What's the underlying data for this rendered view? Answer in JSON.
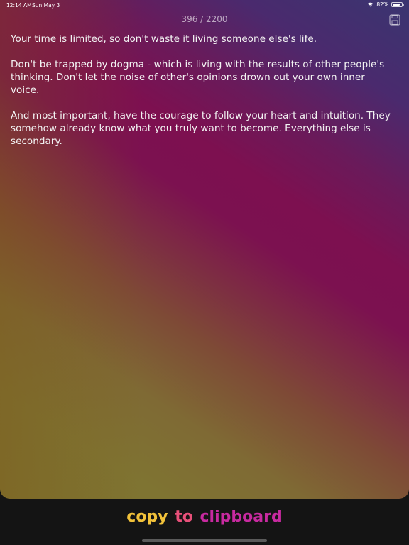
{
  "status_bar": {
    "time": "12:14 AM",
    "date": "Sun May 3",
    "battery_percent": "82%",
    "battery_level": 0.82
  },
  "counter": "396 / 2200",
  "save_icon": "floppy-disk-icon",
  "text": {
    "paragraphs": [
      "Your time is limited, so don't waste it living someone else's life.",
      "Don't be trapped by dogma - which is living with the results of other people's thinking. Don't let the noise of other's opinions drown out your own inner voice.",
      "And most important, have the courage to follow your heart and intuition. They somehow already know what you truly want to become. Everything else is secondary."
    ]
  },
  "copy_button": {
    "word_1": "copy",
    "word_2": "to",
    "word_3": "clipboard"
  },
  "colors": {
    "copy": "#f2c23a",
    "to": "#e8507a",
    "clipboard": "#c82aa0"
  }
}
